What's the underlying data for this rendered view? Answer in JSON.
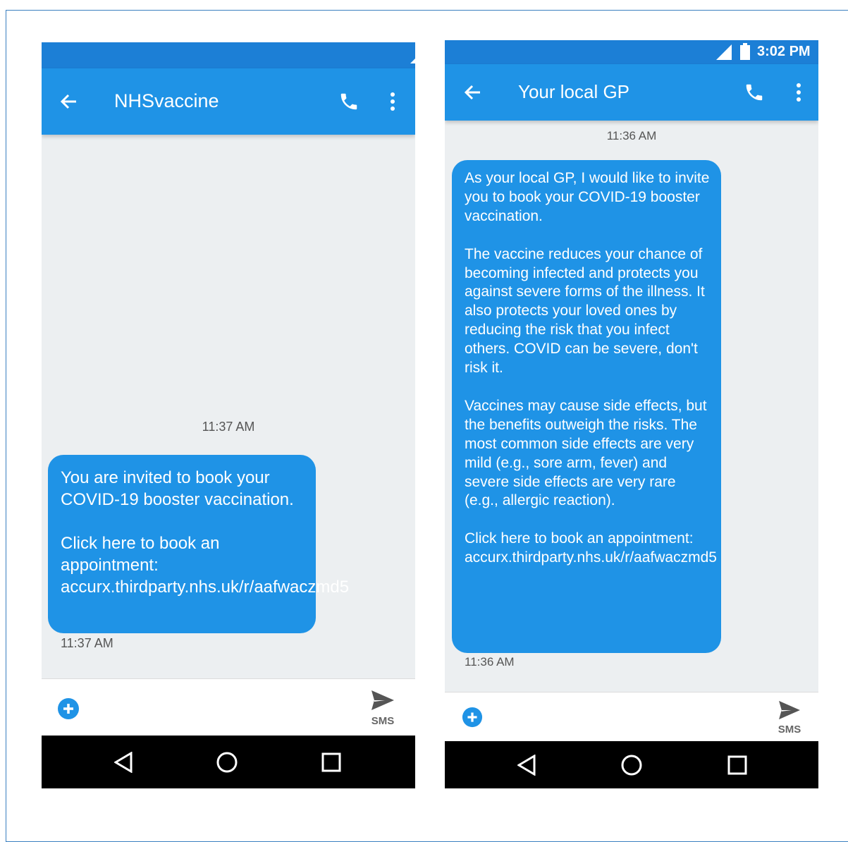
{
  "colors": {
    "status_bar": "#1c7fd6",
    "app_bar": "#1f93e6",
    "bubble": "#1f93e6",
    "conversation_bg": "#eceff1",
    "nav_bar": "#000000"
  },
  "icons": [
    "back-arrow-icon",
    "phone-icon",
    "more-vert-icon",
    "signal-icon",
    "battery-icon",
    "add-circle-icon",
    "send-icon",
    "nav-back-icon",
    "nav-home-icon",
    "nav-recents-icon"
  ],
  "left_phone": {
    "contact": "NHSvaccine",
    "time_divider": "11:37 AM",
    "message": "You are invited to book your COVID-19 booster vaccination.\n\nClick here to book an appointment: accurx.thirdparty.nhs.uk/r/aafwaczmd5",
    "message_time": "11:37 AM",
    "send_label": "SMS"
  },
  "right_phone": {
    "clock": "3:02 PM",
    "contact": "Your local GP",
    "time_divider": "11:36 AM",
    "message": "As your local GP, I would like to invite you to book your COVID-19 booster vaccination.\n\nThe vaccine reduces your chance of becoming infected and protects you against severe forms of the illness. It also protects your loved ones by reducing the risk that you infect others. COVID can be severe, don't risk it.\n\nVaccines may cause side effects, but the benefits outweigh the risks. The most common side effects are very mild (e.g., sore arm, fever) and severe side effects are very rare (e.g., allergic reaction).\n\nClick here to book an appointment: accurx.thirdparty.nhs.uk/r/aafwaczmd5",
    "message_time": "11:36 AM",
    "send_label": "SMS"
  }
}
